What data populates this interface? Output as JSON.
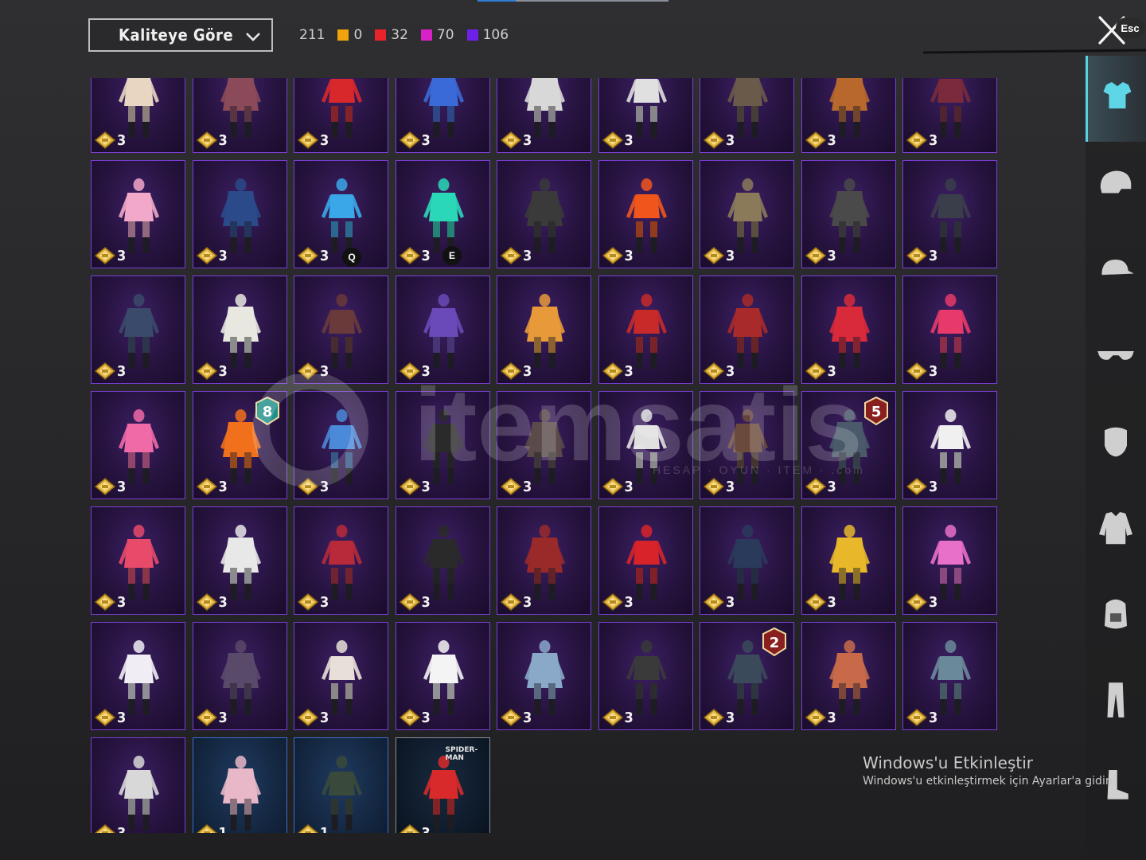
{
  "header": {
    "sort_label": "Kaliteye Göre",
    "total_count": "211",
    "rarities": [
      {
        "color": "#f0a30a",
        "count": "0"
      },
      {
        "color": "#e8232b",
        "count": "32"
      },
      {
        "color": "#d822c8",
        "count": "70"
      },
      {
        "color": "#6d21e8",
        "count": "106"
      }
    ],
    "close_hint": "Esc"
  },
  "key_hints": {
    "q": "Q",
    "e": "E"
  },
  "watermark": {
    "text": "itemsatis",
    "sub": "HESAP · OYUN · ITEM · .com"
  },
  "windows_notice": {
    "title": "Windows'u Etkinleştir",
    "subtitle": "Windows'u etkinleştirmek için Ayarlar'a gidin."
  },
  "sidebar": [
    {
      "icon": "outfit-icon",
      "active": true
    },
    {
      "icon": "helmet-icon",
      "active": false
    },
    {
      "icon": "cap-icon",
      "active": false
    },
    {
      "icon": "glasses-icon",
      "active": false
    },
    {
      "icon": "mask-icon",
      "active": false
    },
    {
      "icon": "jacket-icon",
      "active": false
    },
    {
      "icon": "backpack-icon",
      "active": false
    },
    {
      "icon": "pants-icon",
      "active": false
    },
    {
      "icon": "shoes-icon",
      "active": false
    }
  ],
  "items": [
    {
      "count": "3",
      "tone": "#e8d6c2"
    },
    {
      "count": "3",
      "tone": "#8a4a5a"
    },
    {
      "count": "3",
      "tone": "#d8282c"
    },
    {
      "count": "3",
      "tone": "#3a6ad8"
    },
    {
      "count": "3",
      "tone": "#d8d8d8"
    },
    {
      "count": "3",
      "tone": "#e0e0e0"
    },
    {
      "count": "3",
      "tone": "#6a5a4a"
    },
    {
      "count": "3",
      "tone": "#b8682c"
    },
    {
      "count": "3",
      "tone": "#7a2a3a"
    },
    {
      "count": "3",
      "tone": "#f2a8c8"
    },
    {
      "count": "3",
      "tone": "#2a4a8a"
    },
    {
      "count": "3",
      "tone": "#3aa8e8"
    },
    {
      "count": "3",
      "tone": "#2ad8b8"
    },
    {
      "count": "3",
      "tone": "#3a3a3a"
    },
    {
      "count": "3",
      "tone": "#f0561c"
    },
    {
      "count": "3",
      "tone": "#8a7a5a"
    },
    {
      "count": "3",
      "tone": "#4a4a4a"
    },
    {
      "count": "3",
      "tone": "#3a3e4a"
    },
    {
      "count": "3",
      "tone": "#3a4a6a"
    },
    {
      "count": "3",
      "tone": "#e8e8e0"
    },
    {
      "count": "3",
      "tone": "#6a3a3a"
    },
    {
      "count": "3",
      "tone": "#6a4ab8"
    },
    {
      "count": "3",
      "tone": "#e89a3a"
    },
    {
      "count": "3",
      "tone": "#c82a2a"
    },
    {
      "count": "3",
      "tone": "#a82a2a"
    },
    {
      "count": "3",
      "tone": "#d82a3a"
    },
    {
      "count": "3",
      "tone": "#e83a6a"
    },
    {
      "count": "3",
      "tone": "#f06aa8"
    },
    {
      "count": "3",
      "tone": "#f0701c",
      "badge": "8"
    },
    {
      "count": "3",
      "tone": "#4a8ad8"
    },
    {
      "count": "3",
      "tone": "#2a2a2a"
    },
    {
      "count": "3",
      "tone": "#5a4a4a"
    },
    {
      "count": "3",
      "tone": "#e0e0e0"
    },
    {
      "count": "3",
      "tone": "#6a4a3a"
    },
    {
      "count": "3",
      "tone": "#4a5a6a",
      "badge": "5"
    },
    {
      "count": "3",
      "tone": "#f0f0f0"
    },
    {
      "count": "3",
      "tone": "#e84a6a"
    },
    {
      "count": "3",
      "tone": "#e8e8e8"
    },
    {
      "count": "3",
      "tone": "#b82a3a"
    },
    {
      "count": "3",
      "tone": "#2a2a2a"
    },
    {
      "count": "3",
      "tone": "#9a2a2a"
    },
    {
      "count": "3",
      "tone": "#d8232b"
    },
    {
      "count": "3",
      "tone": "#2a3a5a"
    },
    {
      "count": "3",
      "tone": "#e8b82a"
    },
    {
      "count": "3",
      "tone": "#e870c8"
    },
    {
      "count": "3",
      "tone": "#f0eef4"
    },
    {
      "count": "3",
      "tone": "#5a4a6a"
    },
    {
      "count": "3",
      "tone": "#e8e0d8"
    },
    {
      "count": "3",
      "tone": "#f4f4f4"
    },
    {
      "count": "3",
      "tone": "#8aa8c8"
    },
    {
      "count": "3",
      "tone": "#3a3a3a"
    },
    {
      "count": "3",
      "tone": "#3a4a5a",
      "badge": "2"
    },
    {
      "count": "3",
      "tone": "#c86a4a"
    },
    {
      "count": "3",
      "tone": "#6a8a9a"
    },
    {
      "count": "3",
      "tone": "#d8d8d8"
    },
    {
      "count": "1",
      "tone": "#e8b8c8",
      "style": "blue"
    },
    {
      "count": "1",
      "tone": "#3a4a3a",
      "style": "blue"
    },
    {
      "count": "3",
      "tone": "#d82a2a",
      "style": "spider",
      "label": "SPIDER-MAN"
    }
  ]
}
